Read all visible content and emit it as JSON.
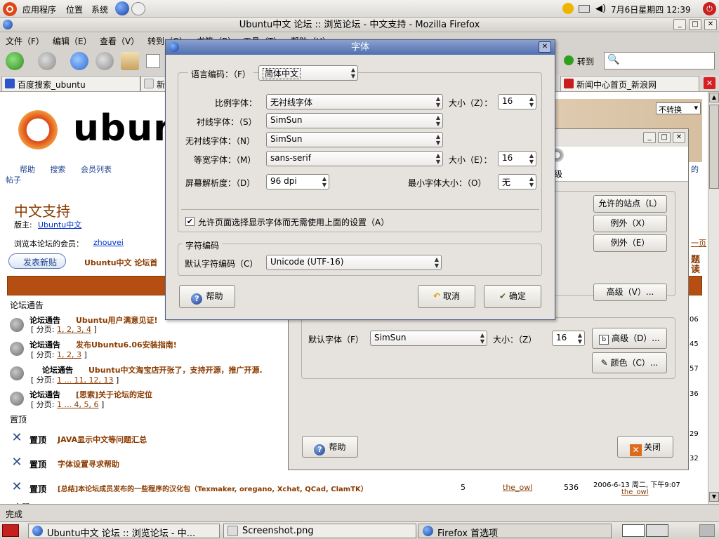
{
  "top_panel": {
    "menus": [
      "应用程序",
      "位置",
      "系统"
    ],
    "clock": "7月6日星期四 12:39"
  },
  "firefox": {
    "title": "Ubuntu中文 论坛 :: 浏览论坛 - 中文支持 - Mozilla Firefox",
    "menu": [
      "文件（F）",
      "编辑（E）",
      "查看（V）",
      "转到（G）",
      "书签（B）",
      "工具（T）",
      "帮助（H）"
    ],
    "go_label": "转到",
    "tabs": [
      "百度搜索_ubuntu",
      "新",
      "新闻中心首页_新浪网"
    ],
    "status": "完成"
  },
  "forum": {
    "logo_text": "ubun",
    "nav": [
      "帮助",
      "搜索",
      "会员列表"
    ],
    "nav_posts": "帖子",
    "nav_right_de": "的",
    "forum_title": "中文支持",
    "moderator_label": "版主:",
    "moderator": "Ubuntu中文",
    "members_label": "浏览本论坛的会员：",
    "member": "zhouvei",
    "post_button": "发表新贴",
    "breadcrumb": "Ubuntu中文 论坛首",
    "no_convert": "不转换",
    "side_page": "一页",
    "side_title1": "题",
    "side_title2": "读",
    "section_announce": "论坛通告",
    "section_sticky": "置顶",
    "section_more": "主题",
    "announce_label": "论坛通告",
    "sticky_label": "置顶",
    "pages_label": "分页:",
    "announcements": [
      {
        "title": "Ubuntu用户满意见证!",
        "pages": "1, 2, 3, 4",
        "side": "06"
      },
      {
        "title": "发布Ubuntu6.06安装指南!",
        "pages": "1, 2, 3",
        "side": "45"
      },
      {
        "title": "Ubuntu中文淘宝店开张了，支持开源，推广开源.",
        "pages": "1 ... 11, 12, 13",
        "side": "57"
      },
      {
        "title": "[思索]关于论坛的定位",
        "pages": "1 ... 4, 5, 6",
        "side": "36"
      }
    ],
    "stickies": [
      {
        "title": "JAVA显示中文等问题汇总",
        "side": "29"
      },
      {
        "title": "字体设置寻求帮助",
        "side": "32"
      },
      {
        "title": "[总结]本论坛成员发布的一些程序的汉化包（Texmaker, oregano, Xchat, QCad, ClamTK）",
        "replies": "5",
        "author": "the_owl",
        "views": "536",
        "date": "2006-6-13 周二, 下午9:07",
        "last": "the_owl"
      }
    ]
  },
  "prefs": {
    "right_tab": "级",
    "allowed_sites": "允许的站点（L）",
    "exception1": "例外（X）",
    "exception2": "例外（E）",
    "advanced1": "高级（V）...",
    "default_font_label": "默认字体（F）",
    "default_font": "SimSun",
    "size_label": "大小：（Z）",
    "size": "16",
    "advanced2": "高级（D）...",
    "colors": "颜色（C）...",
    "help": "帮助",
    "close": "关闭"
  },
  "fonts": {
    "title": "字体",
    "lang_label": "语言编码：（F）",
    "lang_value": "简体中文",
    "proportional_label": "比例字体：",
    "proportional_value": "无衬线字体",
    "size_z_label": "大小（Z）：",
    "size_z_value": "16",
    "serif_label": "衬线字体：（S）",
    "serif_value": "SimSun",
    "sans_label": "无衬线字体：（N）",
    "sans_value": "SimSun",
    "mono_label": "等宽字体：（M）",
    "mono_value": "sans-serif",
    "size_e_label": "大小（E）：",
    "size_e_value": "16",
    "resolution_label": "屏幕解析度：（D）",
    "resolution_value": "96 dpi",
    "min_size_label": "最小字体大小：（O）",
    "min_size_value": "无",
    "allow_pages": "允许页面选择显示字体而无需使用上面的设置（A）",
    "charset_section": "字符编码",
    "default_charset_label": "默认字符编码（C）",
    "default_charset_value": "Unicode (UTF-16)",
    "help": "帮助",
    "cancel": "取消",
    "ok": "确定"
  },
  "taskbar": {
    "items": [
      "Ubuntu中文 论坛 :: 浏览论坛 - 中...",
      "Screenshot.png",
      "Firefox 首选项"
    ]
  }
}
